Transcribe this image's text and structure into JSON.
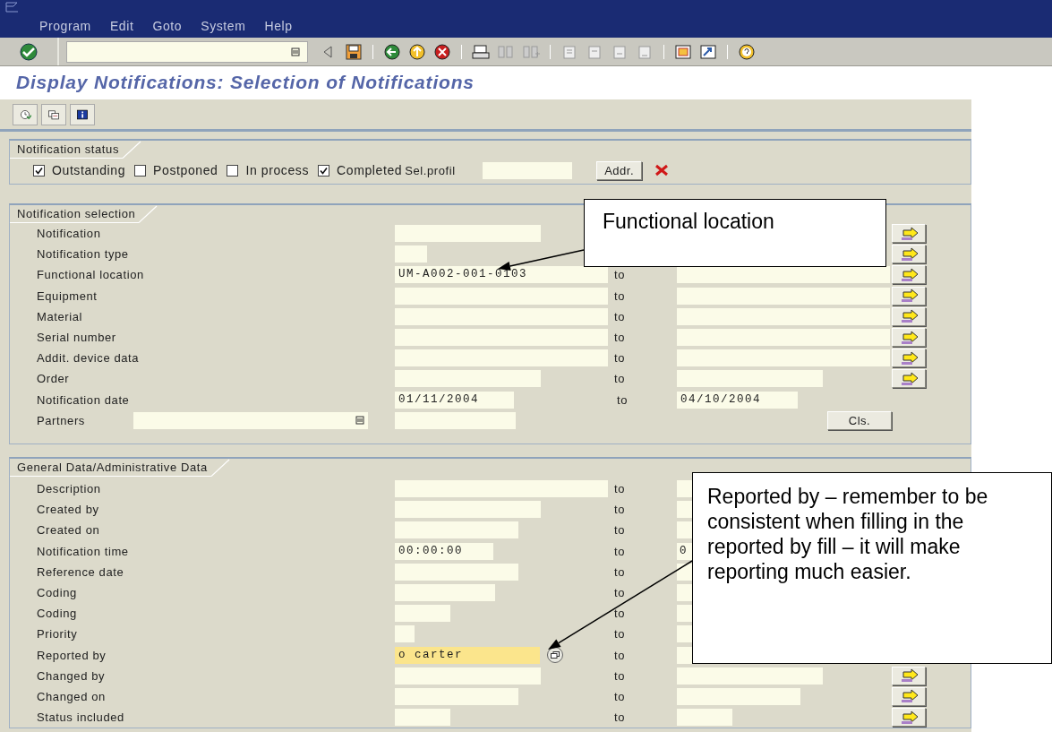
{
  "menu": [
    "Program",
    "Edit",
    "Goto",
    "System",
    "Help"
  ],
  "title": "Display Notifications: Selection of Notifications",
  "notification_status": {
    "title": "Notification status",
    "checkboxes": [
      {
        "label": "Outstanding",
        "checked": true
      },
      {
        "label": "Postponed",
        "checked": false
      },
      {
        "label": "In process",
        "checked": false
      },
      {
        "label": "Completed",
        "checked": true
      }
    ],
    "profile_label": "Sel.profil",
    "address_button": "Addr."
  },
  "notification_selection": {
    "title": "Notification selection",
    "rows": [
      {
        "kind": "range",
        "label": "Notification",
        "more": true
      },
      {
        "kind": "range",
        "label": "Notification type",
        "more": true
      },
      {
        "kind": "range",
        "label": "Functional location",
        "value": "UM-A002-001-0103",
        "to_label": "to",
        "more": true
      },
      {
        "kind": "range",
        "label": "Equipment",
        "to_label": "to",
        "more": true
      },
      {
        "kind": "range",
        "label": "Material",
        "to_label": "to",
        "more": true
      },
      {
        "kind": "range",
        "label": "Serial number",
        "to_label": "to",
        "more": true
      },
      {
        "kind": "range",
        "label": "Addit. device data",
        "to_label": "to",
        "more": true
      },
      {
        "kind": "range",
        "label": "Order",
        "to_label": "to",
        "more": true
      },
      {
        "kind": "range",
        "label": "Notification date",
        "value": "01/11/2004",
        "to_label": "to",
        "to_value": "04/10/2004",
        "more": false
      },
      {
        "kind": "partners",
        "label": "Partners",
        "button": "Cls."
      }
    ]
  },
  "general_data": {
    "title": "General Data/Administrative Data",
    "rows": [
      {
        "label": "Description",
        "to_label": "to",
        "focused": false,
        "help": false,
        "more": false
      },
      {
        "label": "Created by",
        "to_label": "to",
        "focused": false,
        "help": false,
        "more": false
      },
      {
        "label": "Created on",
        "to_label": "to",
        "focused": false,
        "help": false,
        "more": false
      },
      {
        "label": "Notification time",
        "value": "00:00:00",
        "to_label": "to",
        "to_value": "0",
        "focused": false,
        "help": false,
        "more": false
      },
      {
        "label": "Reference date",
        "to_label": "to",
        "focused": false,
        "help": false,
        "more": false
      },
      {
        "label": "Coding",
        "to_label": "to",
        "focused": false,
        "help": false,
        "more": false
      },
      {
        "label": "Coding",
        "to_label": "to",
        "focused": false,
        "help": false,
        "more": false
      },
      {
        "label": "Priority",
        "to_label": "to",
        "focused": false,
        "help": false,
        "more": false
      },
      {
        "label": "Reported by",
        "value": "o carter",
        "to_label": "to",
        "focused": true,
        "help": true,
        "more": false
      },
      {
        "label": "Changed by",
        "to_label": "to",
        "focused": false,
        "help": false,
        "more": true
      },
      {
        "label": "Changed on",
        "to_label": "to",
        "focused": false,
        "help": false,
        "more": true
      },
      {
        "label": "Status included",
        "to_label": "to",
        "focused": false,
        "help": false,
        "more": true
      }
    ]
  },
  "callouts": [
    {
      "text": "Functional location"
    },
    {
      "text": "Reported by – remember to be consistent when filling in the reported by fill – it will make reporting much easier."
    }
  ]
}
